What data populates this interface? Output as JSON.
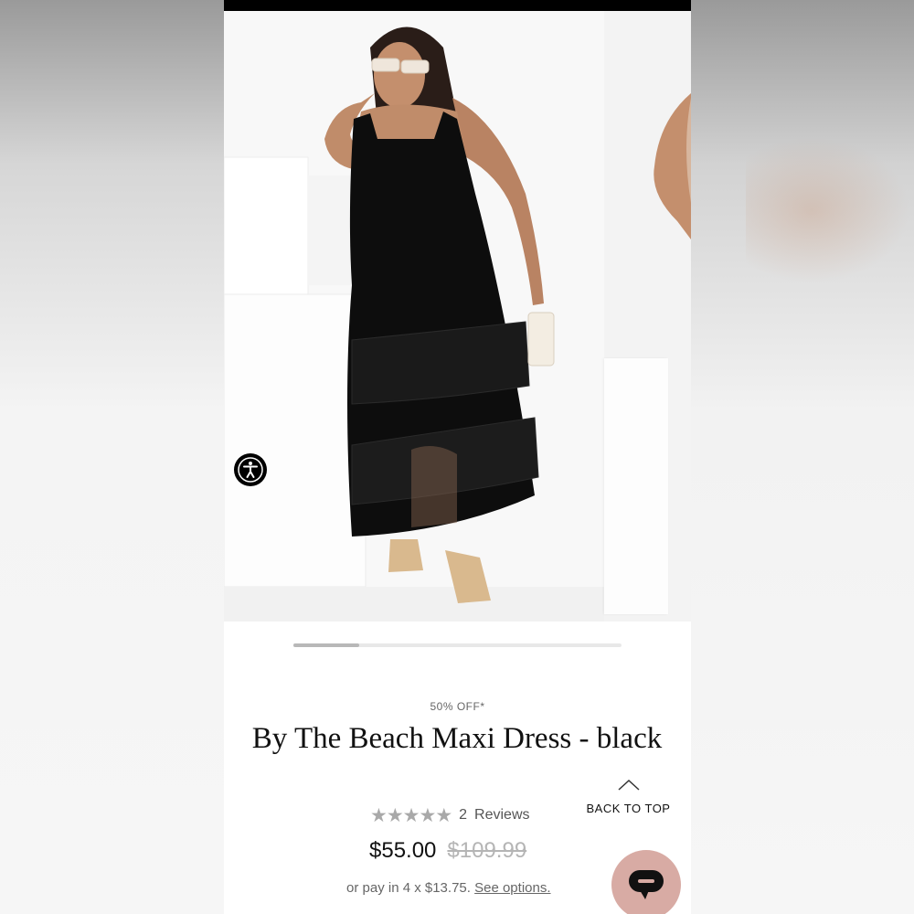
{
  "product": {
    "discount_label": "50% OFF*",
    "title": "By The Beach Maxi Dress - black",
    "rating_value": 0,
    "rating_max": 5,
    "review_count": "2",
    "reviews_label": "Reviews",
    "price": "$55.00",
    "original_price": "$109.99",
    "installments_text": "or pay in 4 x $13.75.",
    "installments_link": "See options."
  },
  "gallery": {
    "current_image": 1,
    "progress_fraction": 0.2
  },
  "back_to_top": {
    "label": "BACK TO TOP"
  },
  "icons": {
    "accessibility": "accessibility-icon",
    "back_to_top": "chevron-up-icon",
    "chat": "chat-icon",
    "star": "star-icon"
  },
  "colors": {
    "chat_button": "#d8aba4",
    "stars": "#a9a9a9",
    "old_price": "#b5b5b5"
  }
}
